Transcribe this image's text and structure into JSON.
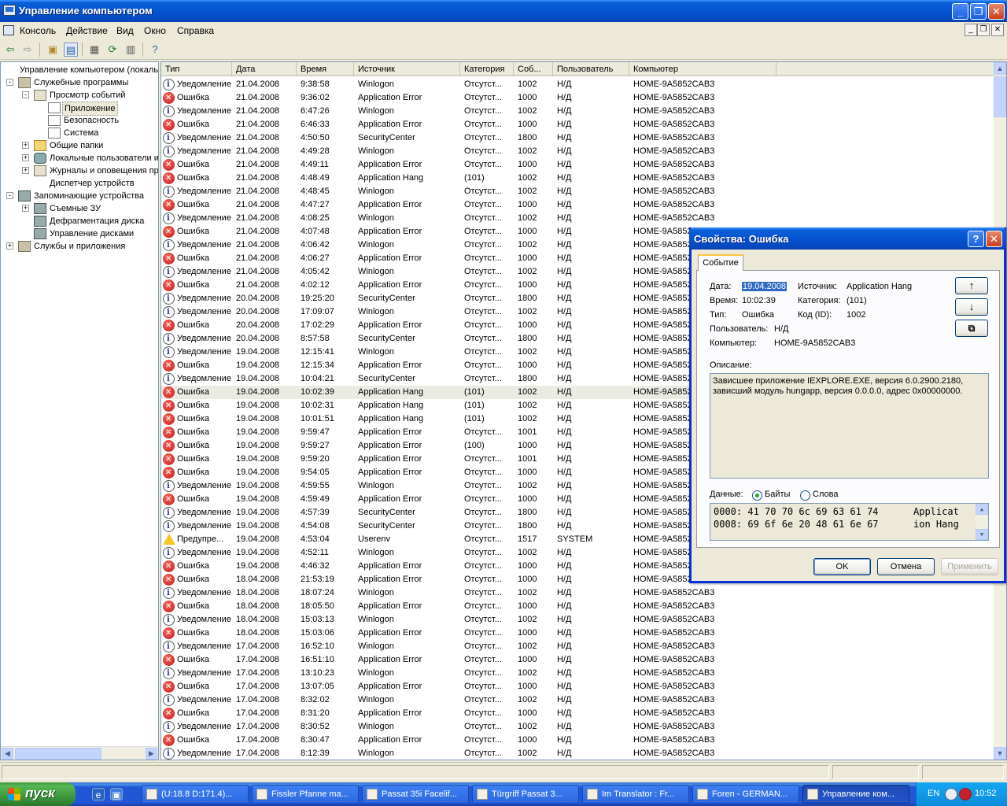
{
  "window": {
    "title": "Управление компьютером"
  },
  "menu": [
    "Консоль",
    "Действие",
    "Вид",
    "Окно",
    "Справка"
  ],
  "toolbar_icons": [
    "back-icon",
    "forward-icon",
    "up-folder-icon",
    "show-tree-icon",
    "properties-icon",
    "refresh-icon",
    "export-list-icon",
    "help-icon"
  ],
  "tree": [
    {
      "label": "Управление компьютером (локаль",
      "level": 0,
      "expander": "",
      "icon": "computer"
    },
    {
      "label": "Служебные программы",
      "level": 1,
      "expander": "-",
      "icon": "tool"
    },
    {
      "label": "Просмотр событий",
      "level": 2,
      "expander": "-",
      "icon": "ev"
    },
    {
      "label": "Приложение",
      "level": 3,
      "expander": "",
      "icon": "log",
      "selected": true
    },
    {
      "label": "Безопасность",
      "level": 3,
      "expander": "",
      "icon": "log"
    },
    {
      "label": "Система",
      "level": 3,
      "expander": "",
      "icon": "log"
    },
    {
      "label": "Общие папки",
      "level": 2,
      "expander": "+",
      "icon": "fold"
    },
    {
      "label": "Локальные пользователи и",
      "level": 2,
      "expander": "+",
      "icon": "user"
    },
    {
      "label": "Журналы и оповещения пр",
      "level": 2,
      "expander": "+",
      "icon": "ev"
    },
    {
      "label": "Диспетчер устройств",
      "level": 2,
      "expander": "",
      "icon": "computer"
    },
    {
      "label": "Запоминающие устройства",
      "level": 1,
      "expander": "-",
      "icon": "disk"
    },
    {
      "label": "Съемные ЗУ",
      "level": 2,
      "expander": "+",
      "icon": "disk"
    },
    {
      "label": "Дефрагментация диска",
      "level": 2,
      "expander": "",
      "icon": "disk"
    },
    {
      "label": "Управление дисками",
      "level": 2,
      "expander": "",
      "icon": "disk"
    },
    {
      "label": "Службы и приложения",
      "level": 1,
      "expander": "+",
      "icon": "tool"
    }
  ],
  "columns": [
    "Тип",
    "Дата",
    "Время",
    "Источник",
    "Категория",
    "Соб...",
    "Пользователь",
    "Компьютер"
  ],
  "events": [
    [
      "info",
      "Уведомление",
      "21.04.2008",
      "9:38:58",
      "Winlogon",
      "Отсутст...",
      "1002",
      "Н/Д",
      "HOME-9A5852CAB3"
    ],
    [
      "err",
      "Ошибка",
      "21.04.2008",
      "9:36:02",
      "Application Error",
      "Отсутст...",
      "1000",
      "Н/Д",
      "HOME-9A5852CAB3"
    ],
    [
      "info",
      "Уведомление",
      "21.04.2008",
      "6:47:26",
      "Winlogon",
      "Отсутст...",
      "1002",
      "Н/Д",
      "HOME-9A5852CAB3"
    ],
    [
      "err",
      "Ошибка",
      "21.04.2008",
      "6:46:33",
      "Application Error",
      "Отсутст...",
      "1000",
      "Н/Д",
      "HOME-9A5852CAB3"
    ],
    [
      "info",
      "Уведомление",
      "21.04.2008",
      "4:50:50",
      "SecurityCenter",
      "Отсутст...",
      "1800",
      "Н/Д",
      "HOME-9A5852CAB3"
    ],
    [
      "info",
      "Уведомление",
      "21.04.2008",
      "4:49:28",
      "Winlogon",
      "Отсутст...",
      "1002",
      "Н/Д",
      "HOME-9A5852CAB3"
    ],
    [
      "err",
      "Ошибка",
      "21.04.2008",
      "4:49:11",
      "Application Error",
      "Отсутст...",
      "1000",
      "Н/Д",
      "HOME-9A5852CAB3"
    ],
    [
      "err",
      "Ошибка",
      "21.04.2008",
      "4:48:49",
      "Application Hang",
      "(101)",
      "1002",
      "Н/Д",
      "HOME-9A5852CAB3"
    ],
    [
      "info",
      "Уведомление",
      "21.04.2008",
      "4:48:45",
      "Winlogon",
      "Отсутст...",
      "1002",
      "Н/Д",
      "HOME-9A5852CAB3"
    ],
    [
      "err",
      "Ошибка",
      "21.04.2008",
      "4:47:27",
      "Application Error",
      "Отсутст...",
      "1000",
      "Н/Д",
      "HOME-9A5852CAB3"
    ],
    [
      "info",
      "Уведомление",
      "21.04.2008",
      "4:08:25",
      "Winlogon",
      "Отсутст...",
      "1002",
      "Н/Д",
      "HOME-9A5852CAB3"
    ],
    [
      "err",
      "Ошибка",
      "21.04.2008",
      "4:07:48",
      "Application Error",
      "Отсутст...",
      "1000",
      "Н/Д",
      "HOME-9A5852"
    ],
    [
      "info",
      "Уведомление",
      "21.04.2008",
      "4:06:42",
      "Winlogon",
      "Отсутст...",
      "1002",
      "Н/Д",
      "HOME-9A5852"
    ],
    [
      "err",
      "Ошибка",
      "21.04.2008",
      "4:06:27",
      "Application Error",
      "Отсутст...",
      "1000",
      "Н/Д",
      "HOME-9A5852"
    ],
    [
      "info",
      "Уведомление",
      "21.04.2008",
      "4:05:42",
      "Winlogon",
      "Отсутст...",
      "1002",
      "Н/Д",
      "HOME-9A5852"
    ],
    [
      "err",
      "Ошибка",
      "21.04.2008",
      "4:02:12",
      "Application Error",
      "Отсутст...",
      "1000",
      "Н/Д",
      "HOME-9A5852"
    ],
    [
      "info",
      "Уведомление",
      "20.04.2008",
      "19:25:20",
      "SecurityCenter",
      "Отсутст...",
      "1800",
      "Н/Д",
      "HOME-9A5852"
    ],
    [
      "info",
      "Уведомление",
      "20.04.2008",
      "17:09:07",
      "Winlogon",
      "Отсутст...",
      "1002",
      "Н/Д",
      "HOME-9A5852"
    ],
    [
      "err",
      "Ошибка",
      "20.04.2008",
      "17:02:29",
      "Application Error",
      "Отсутст...",
      "1000",
      "Н/Д",
      "HOME-9A5852"
    ],
    [
      "info",
      "Уведомление",
      "20.04.2008",
      "8:57:58",
      "SecurityCenter",
      "Отсутст...",
      "1800",
      "Н/Д",
      "HOME-9A5852"
    ],
    [
      "info",
      "Уведомление",
      "19.04.2008",
      "12:15:41",
      "Winlogon",
      "Отсутст...",
      "1002",
      "Н/Д",
      "HOME-9A5852"
    ],
    [
      "err",
      "Ошибка",
      "19.04.2008",
      "12:15:34",
      "Application Error",
      "Отсутст...",
      "1000",
      "Н/Д",
      "HOME-9A5852"
    ],
    [
      "info",
      "Уведомление",
      "19.04.2008",
      "10:04:21",
      "SecurityCenter",
      "Отсутст...",
      "1800",
      "Н/Д",
      "HOME-9A5852"
    ],
    [
      "err",
      "Ошибка",
      "19.04.2008",
      "10:02:39",
      "Application Hang",
      "(101)",
      "1002",
      "Н/Д",
      "HOME-9A5852"
    ],
    [
      "err",
      "Ошибка",
      "19.04.2008",
      "10:02:31",
      "Application Hang",
      "(101)",
      "1002",
      "Н/Д",
      "HOME-9A5852"
    ],
    [
      "err",
      "Ошибка",
      "19.04.2008",
      "10:01:51",
      "Application Hang",
      "(101)",
      "1002",
      "Н/Д",
      "HOME-9A5852"
    ],
    [
      "err",
      "Ошибка",
      "19.04.2008",
      "9:59:47",
      "Application Error",
      "Отсутст...",
      "1001",
      "Н/Д",
      "HOME-9A5852"
    ],
    [
      "err",
      "Ошибка",
      "19.04.2008",
      "9:59:27",
      "Application Error",
      "(100)",
      "1000",
      "Н/Д",
      "HOME-9A5852"
    ],
    [
      "err",
      "Ошибка",
      "19.04.2008",
      "9:59:20",
      "Application Error",
      "Отсутст...",
      "1001",
      "Н/Д",
      "HOME-9A5852"
    ],
    [
      "err",
      "Ошибка",
      "19.04.2008",
      "9:54:05",
      "Application Error",
      "Отсутст...",
      "1000",
      "Н/Д",
      "HOME-9A5852"
    ],
    [
      "info",
      "Уведомление",
      "19.04.2008",
      "4:59:55",
      "Winlogon",
      "Отсутст...",
      "1002",
      "Н/Д",
      "HOME-9A5852"
    ],
    [
      "err",
      "Ошибка",
      "19.04.2008",
      "4:59:49",
      "Application Error",
      "Отсутст...",
      "1000",
      "Н/Д",
      "HOME-9A5852"
    ],
    [
      "info",
      "Уведомление",
      "19.04.2008",
      "4:57:39",
      "SecurityCenter",
      "Отсутст...",
      "1800",
      "Н/Д",
      "HOME-9A5852"
    ],
    [
      "info",
      "Уведомление",
      "19.04.2008",
      "4:54:08",
      "SecurityCenter",
      "Отсутст...",
      "1800",
      "Н/Д",
      "HOME-9A5852"
    ],
    [
      "warn",
      "Предупре...",
      "19.04.2008",
      "4:53:04",
      "Userenv",
      "Отсутст...",
      "1517",
      "SYSTEM",
      "HOME-9A5852"
    ],
    [
      "info",
      "Уведомление",
      "19.04.2008",
      "4:52:11",
      "Winlogon",
      "Отсутст...",
      "1002",
      "Н/Д",
      "HOME-9A5852"
    ],
    [
      "err",
      "Ошибка",
      "19.04.2008",
      "4:46:32",
      "Application Error",
      "Отсутст...",
      "1000",
      "Н/Д",
      "HOME-9A5852"
    ],
    [
      "err",
      "Ошибка",
      "18.04.2008",
      "21:53:19",
      "Application Error",
      "Отсутст...",
      "1000",
      "Н/Д",
      "HOME-9A5852"
    ],
    [
      "info",
      "Уведомление",
      "18.04.2008",
      "18:07:24",
      "Winlogon",
      "Отсутст...",
      "1002",
      "Н/Д",
      "HOME-9A5852CAB3"
    ],
    [
      "err",
      "Ошибка",
      "18.04.2008",
      "18:05:50",
      "Application Error",
      "Отсутст...",
      "1000",
      "Н/Д",
      "HOME-9A5852CAB3"
    ],
    [
      "info",
      "Уведомление",
      "18.04.2008",
      "15:03:13",
      "Winlogon",
      "Отсутст...",
      "1002",
      "Н/Д",
      "HOME-9A5852CAB3"
    ],
    [
      "err",
      "Ошибка",
      "18.04.2008",
      "15:03:06",
      "Application Error",
      "Отсутст...",
      "1000",
      "Н/Д",
      "HOME-9A5852CAB3"
    ],
    [
      "info",
      "Уведомление",
      "17.04.2008",
      "16:52:10",
      "Winlogon",
      "Отсутст...",
      "1002",
      "Н/Д",
      "HOME-9A5852CAB3"
    ],
    [
      "err",
      "Ошибка",
      "17.04.2008",
      "16:51:10",
      "Application Error",
      "Отсутст...",
      "1000",
      "Н/Д",
      "HOME-9A5852CAB3"
    ],
    [
      "info",
      "Уведомление",
      "17.04.2008",
      "13:10:23",
      "Winlogon",
      "Отсутст...",
      "1002",
      "Н/Д",
      "HOME-9A5852CAB3"
    ],
    [
      "err",
      "Ошибка",
      "17.04.2008",
      "13:07:05",
      "Application Error",
      "Отсутст...",
      "1000",
      "Н/Д",
      "HOME-9A5852CAB3"
    ],
    [
      "info",
      "Уведомление",
      "17.04.2008",
      "8:32:02",
      "Winlogon",
      "Отсутст...",
      "1002",
      "Н/Д",
      "HOME-9A5852CAB3"
    ],
    [
      "err",
      "Ошибка",
      "17.04.2008",
      "8:31:20",
      "Application Error",
      "Отсутст...",
      "1000",
      "Н/Д",
      "HOME-9A5852CAB3"
    ],
    [
      "info",
      "Уведомление",
      "17.04.2008",
      "8:30:52",
      "Winlogon",
      "Отсутст...",
      "1002",
      "Н/Д",
      "HOME-9A5852CAB3"
    ],
    [
      "err",
      "Ошибка",
      "17.04.2008",
      "8:30:47",
      "Application Error",
      "Отсутст...",
      "1000",
      "Н/Д",
      "HOME-9A5852CAB3"
    ],
    [
      "info",
      "Уведомление",
      "17.04.2008",
      "8:12:39",
      "Winlogon",
      "Отсутст...",
      "1002",
      "Н/Д",
      "HOME-9A5852CAB3"
    ]
  ],
  "highlighted_row": 23,
  "dialog": {
    "title": "Свойства: Ошибка",
    "tab": "Событие",
    "date_label": "Дата:",
    "date_value": "19.04.2008",
    "source_label": "Источник:",
    "source_value": "Application Hang",
    "time_label": "Время:",
    "time_value": "10:02:39",
    "category_label": "Категория:",
    "category_value": "(101)",
    "type_label": "Тип:",
    "type_value": "Ошибка",
    "id_label": "Код (ID):",
    "id_value": "1002",
    "user_label": "Пользователь:",
    "user_value": "Н/Д",
    "computer_label": "Компьютер:",
    "computer_value": "HOME-9A5852CAB3",
    "description_label": "Описание:",
    "description_line1": "Зависшее приложение IEXPLORE.EXE, версия 6.0.2900.2180,",
    "description_line2": "зависший модуль hungapp, версия 0.0.0.0, адрес 0x00000000.",
    "data_label": "Данные:",
    "radio_bytes": "Байты",
    "radio_words": "Слова",
    "hex_line1": "0000: 41 70 70 6c 69 63 61 74",
    "ascii_line1": "Applicat",
    "hex_line2": "0008: 69 6f 6e 20 48 61 6e 67",
    "ascii_line2": "ion Hang",
    "ok": "OK",
    "cancel": "Отмена",
    "apply": "Применить"
  },
  "taskbar": {
    "start": "пуск",
    "tasks": [
      "(U:18.8 D:171.4)...",
      "Fissler Pfanne ma...",
      "Passat 35i Facelif...",
      "Türgriff Passat 3...",
      "Im Translator : Fr...",
      "Foren - GERMAN...",
      "Управление ком..."
    ],
    "active_task": 6,
    "lang": "EN",
    "clock": "10:52"
  }
}
